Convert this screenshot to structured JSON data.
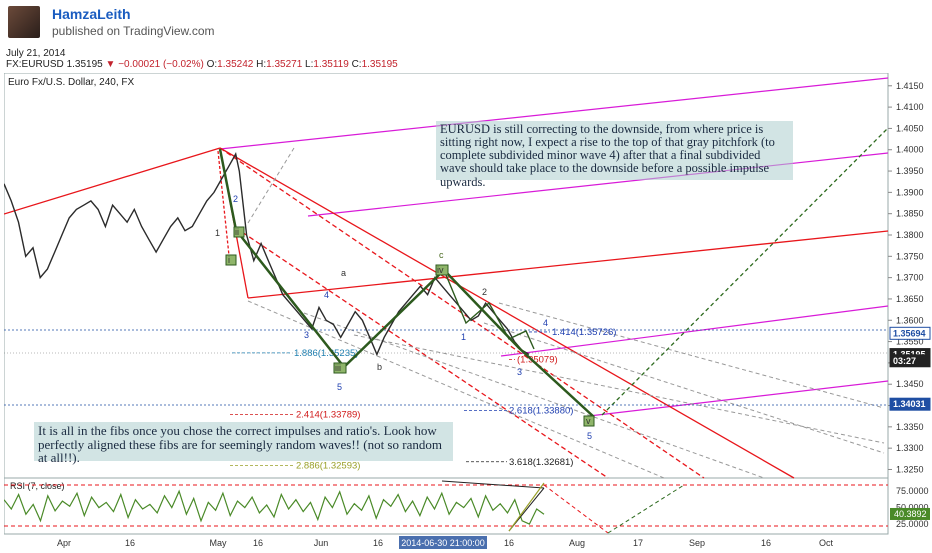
{
  "header": {
    "author": "HamzaLeith",
    "published": "published on TradingView.com",
    "date": "July 21, 2014",
    "symbol_line_prefix": "FX:EURUSD",
    "last": "1.35195",
    "change": "−0.00021 (−0.02%)",
    "o_label": "O:",
    "o": "1.35242",
    "h_label": "H:",
    "h": "1.35271",
    "l_label": "L:",
    "l": "1.35119",
    "c_label": "C:",
    "c": "1.35195"
  },
  "chart_data": {
    "type": "line",
    "title": "Euro Fx/U.S. Dollar, 240, FX",
    "ylim": [
      1.323,
      1.418
    ],
    "y_ticks": [
      "1.4150",
      "1.4100",
      "1.4050",
      "1.4000",
      "1.3950",
      "1.3900",
      "1.3850",
      "1.3800",
      "1.3750",
      "1.3700",
      "1.3650",
      "1.3600",
      "1.3550",
      "1.3500",
      "1.3450",
      "1.3400",
      "1.3350",
      "1.3300",
      "1.3250"
    ],
    "x_ticks": [
      "Apr",
      "16",
      "May",
      "16",
      "Jun",
      "16",
      "Jul",
      "16",
      "Aug",
      "17",
      "Sep",
      "16",
      "Oct"
    ],
    "x_highlight": "2014-06-30 21:00:00",
    "price_labels": [
      {
        "text": "1.35694",
        "value": 1.35694,
        "style": "outline"
      },
      {
        "text": "1.35195",
        "value": 1.35195,
        "style": "dark"
      },
      {
        "text": "03:27",
        "value": 1.3505,
        "style": "dark"
      },
      {
        "text": "1.34031",
        "value": 1.34031,
        "style": "blue"
      }
    ],
    "series": [
      {
        "values": [
          [
            0,
            1.392
          ],
          [
            4,
            1.388
          ],
          [
            8,
            1.383
          ],
          [
            12,
            1.375
          ],
          [
            16,
            1.377
          ],
          [
            20,
            1.37
          ],
          [
            24,
            1.372
          ],
          [
            28,
            1.376
          ],
          [
            32,
            1.38
          ],
          [
            36,
            1.384
          ],
          [
            40,
            1.386
          ],
          [
            44,
            1.387
          ],
          [
            48,
            1.388
          ],
          [
            52,
            1.386
          ],
          [
            56,
            1.382
          ],
          [
            60,
            1.387
          ],
          [
            64,
            1.385
          ],
          [
            68,
            1.383
          ],
          [
            72,
            1.386
          ],
          [
            76,
            1.382
          ],
          [
            80,
            1.379
          ],
          [
            84,
            1.376
          ],
          [
            88,
            1.379
          ],
          [
            92,
            1.382
          ],
          [
            96,
            1.384
          ],
          [
            100,
            1.381
          ],
          [
            104,
            1.382
          ],
          [
            108,
            1.385
          ],
          [
            112,
            1.388
          ],
          [
            116,
            1.39
          ],
          [
            120,
            1.393
          ],
          [
            124,
            1.396
          ],
          [
            128,
            1.399
          ],
          [
            130,
            1.395
          ],
          [
            134,
            1.38
          ],
          [
            138,
            1.374
          ],
          [
            142,
            1.378
          ],
          [
            146,
            1.374
          ],
          [
            150,
            1.37
          ],
          [
            154,
            1.366
          ],
          [
            158,
            1.364
          ],
          [
            162,
            1.362
          ],
          [
            166,
            1.36
          ],
          [
            170,
            1.358
          ],
          [
            174,
            1.363
          ],
          [
            178,
            1.36
          ],
          [
            182,
            1.359
          ],
          [
            186,
            1.356
          ],
          [
            190,
            1.359
          ],
          [
            194,
            1.362
          ],
          [
            198,
            1.36
          ],
          [
            202,
            1.356
          ],
          [
            206,
            1.352
          ],
          [
            210,
            1.356
          ],
          [
            214,
            1.359
          ],
          [
            218,
            1.362
          ],
          [
            222,
            1.364
          ],
          [
            226,
            1.366
          ],
          [
            230,
            1.368
          ],
          [
            234,
            1.366
          ],
          [
            238,
            1.37
          ],
          [
            242,
            1.368
          ],
          [
            246,
            1.366
          ],
          [
            250,
            1.364
          ],
          [
            254,
            1.362
          ],
          [
            258,
            1.36
          ],
          [
            262,
            1.361
          ],
          [
            266,
            1.364
          ],
          [
            270,
            1.362
          ],
          [
            274,
            1.36
          ],
          [
            278,
            1.358
          ],
          [
            282,
            1.355
          ],
          [
            286,
            1.353
          ],
          [
            290,
            1.352
          ]
        ]
      }
    ],
    "fib_labels": [
      {
        "text": "1.414(1.35726)",
        "value": 1.35726
      },
      {
        "text": "1.886(1.35235)",
        "value": 1.35235
      },
      {
        "text": "(1.35079)",
        "value": 1.35079
      },
      {
        "text": "2.414(1.33789)",
        "value": 1.33789
      },
      {
        "text": "2.618(1.33880)",
        "value": 1.3388
      },
      {
        "text": "2.886(1.32593)",
        "value": 1.32593
      },
      {
        "text": "3.618(1.32681)",
        "value": 1.32681
      }
    ],
    "wave_labels": [
      "1",
      "2",
      "i",
      "ii",
      "iii",
      "iv",
      "v",
      "a",
      "b",
      "c",
      "1",
      "2",
      "3",
      "4",
      "5",
      "3",
      "4",
      "5"
    ],
    "rsi": {
      "label": "RSI (7, close)",
      "ylim": [
        10,
        95
      ],
      "y_ticks": [
        "75.0000",
        "50.0000",
        "25.0000"
      ],
      "current": "40.3892",
      "values": [
        62,
        48,
        70,
        40,
        55,
        30,
        68,
        45,
        60,
        52,
        72,
        38,
        66,
        50,
        58,
        44,
        70,
        35,
        62,
        48,
        55,
        42,
        68,
        50,
        75,
        40,
        64,
        30,
        58,
        46,
        72,
        38,
        60,
        50,
        66,
        42,
        54,
        36,
        70,
        48,
        62,
        44,
        58,
        32,
        66,
        50,
        74,
        40,
        56,
        46,
        68,
        34,
        62,
        52,
        70,
        44,
        60,
        38,
        66,
        48,
        72,
        40,
        58,
        50,
        64,
        36,
        68,
        46,
        56,
        42,
        62,
        30,
        25,
        48,
        40
      ]
    }
  },
  "annotations": {
    "top": "EURUSD is still correcting to the downside, from where price is sitting right now, I expect a rise to the top of that gray pitchfork (to complete subdivided minor wave 4) after that a final subdivided wave should take place to the downside before a possible impulse upwards.",
    "bottom": "It is all in the fibs once you chose the correct impulses and ratio's. Look how perfectly aligned these fibs are for seemingly random waves!! (not so random at all!!)."
  },
  "colors": {
    "candle": "#2b2b2b",
    "red": "#e8161b",
    "magenta": "#d81bd8",
    "wave_green": "#2d5a1e",
    "rsi_line": "#4a8a28",
    "blue_label": "#1f4ea3",
    "fib_blue": "#1f3fb0",
    "fib_red": "#d01a1a",
    "fib_olive": "#9aa12a"
  }
}
